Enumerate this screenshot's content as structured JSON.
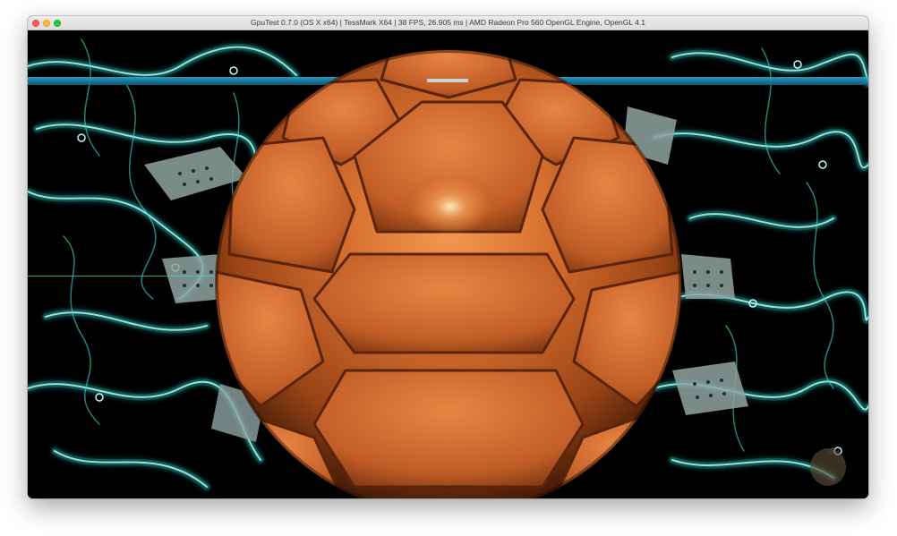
{
  "window": {
    "title": "GpuTest 0.7.0 (OS X x64) | TessMark X64 | 38 FPS, 26.905 ms | AMD Radeon Pro 560 OpenGL Engine, OpenGL 4.1",
    "controls": {
      "close_icon": "close-icon",
      "minimize_icon": "minimize-icon",
      "zoom_icon": "zoom-icon"
    }
  },
  "scene": {
    "description_icon": "tessellated-sphere-render",
    "colors": {
      "background": "#000000",
      "circuit_glow": "#3fd8d2",
      "circuit_core": "#bff6f2",
      "chip": "#8fa3a0",
      "sphere_base": "#c8632b",
      "sphere_highlight": "#f59a52",
      "sphere_shadow": "#4a1d08",
      "scan_line": "#1f8fb5"
    },
    "logo_icon": "apple-logo-icon"
  }
}
